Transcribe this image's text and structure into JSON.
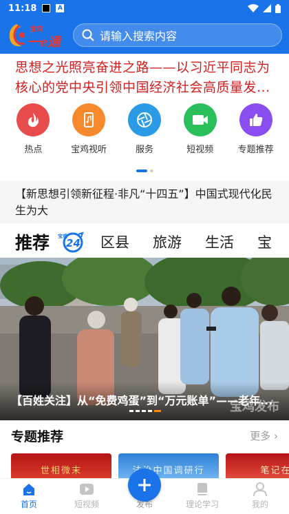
{
  "status_bar": {
    "time": "11:18",
    "a_icon": "A"
  },
  "header": {
    "logo_text_top": "宝鸡",
    "logo_text": "一e通",
    "search_placeholder": "请输入搜索内容"
  },
  "headline": "思想之光照亮奋进之路——以习近平同志为核心的党中央引领中国经济社会高质量发...",
  "quick_nav": [
    {
      "label": "热点",
      "icon": "flame-icon",
      "color": "#e84b4b"
    },
    {
      "label": "宝鸡视听",
      "icon": "phone-music-icon",
      "color": "#f5892c"
    },
    {
      "label": "服务",
      "icon": "aperture-icon",
      "color": "#2b9be6"
    },
    {
      "label": "短视频",
      "icon": "video-icon",
      "color": "#2bbf5c"
    },
    {
      "label": "专题推荐",
      "icon": "thumb-up-icon",
      "color": "#8a4df0"
    }
  ],
  "news_line": "【新思想引领新征程·非凡“十四五”】中国式现代化民生为大",
  "tabs": {
    "main": "推荐",
    "badge_top": "宝鸡",
    "badge_num": "24",
    "items": [
      "区县",
      "旅游",
      "生活",
      "宝"
    ]
  },
  "banner": {
    "caption": "【百姓关注】从“免费鸡蛋”到“万元账单”——老年...",
    "watermark": "宝鸡发布"
  },
  "section": {
    "title": "专题推荐",
    "more": "更多 ›"
  },
  "cards": [
    {
      "text": "世相微末",
      "color": "#c81e1e"
    },
    {
      "text": "法治中国调研行",
      "color": "#3a8de0"
    },
    {
      "text": "笔记在",
      "color": "#c81e1e"
    }
  ],
  "bottom_nav": {
    "home": "首页",
    "short_video": "短视频",
    "publish": "发布",
    "study": "理论学习",
    "mine": "我的"
  },
  "colors": {
    "brand_blue": "#1a73e8",
    "headline_red": "#d21f1f",
    "indicator_orange": "#ff8a00"
  }
}
